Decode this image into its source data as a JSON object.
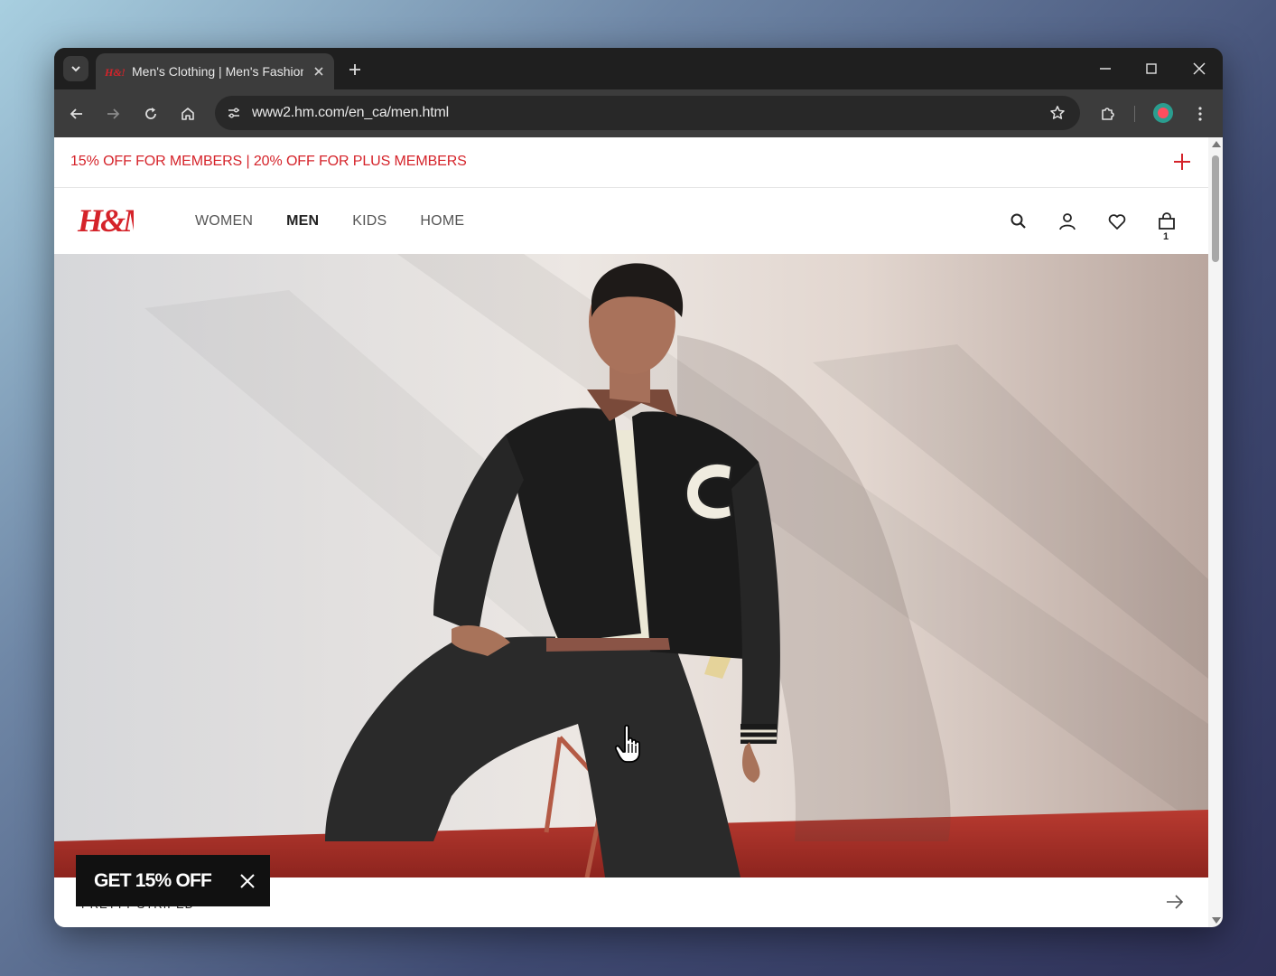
{
  "browser": {
    "tab": {
      "title": "Men's Clothing | Men's Fashion"
    },
    "address": {
      "url": "www2.hm.com/en_ca/men.html"
    }
  },
  "page": {
    "promo_banner": {
      "text": "15% OFF FOR MEMBERS | 20% OFF FOR PLUS MEMBERS"
    },
    "brand": {
      "logo_text": "H&M",
      "accent_color": "#d5232a"
    },
    "nav": [
      {
        "label": "WOMEN",
        "active": false
      },
      {
        "label": "MEN",
        "active": true
      },
      {
        "label": "KIDS",
        "active": false
      },
      {
        "label": "HOME",
        "active": false
      }
    ],
    "header_icons": [
      "search-icon",
      "account-icon",
      "favorites-heart-icon",
      "shopping-bag-icon"
    ],
    "cart": {
      "count": "1"
    },
    "hero": {
      "image": "man-in-black-varsity-jacket-seated-on-chair"
    },
    "bottom_strip": {
      "text": "PRETTY STRIPED"
    },
    "coupon": {
      "label": "GET 15% OFF"
    }
  }
}
